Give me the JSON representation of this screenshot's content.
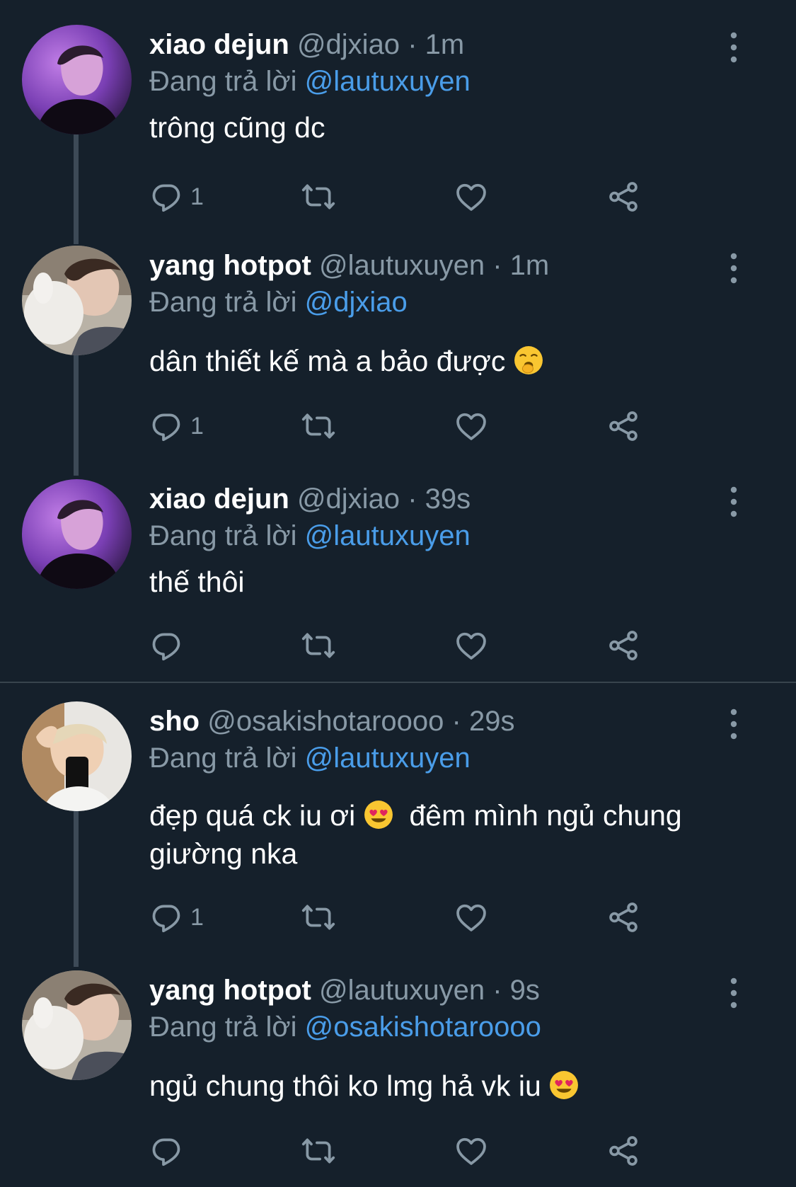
{
  "reply_prefix": "Đang trả lời",
  "colors": {
    "background": "#15202b",
    "secondary_text": "#8899a6",
    "mention": "#4a9de9",
    "thread_line": "#3d4a57"
  },
  "tweets": [
    {
      "name": "xiao dejun",
      "handle": "@djxiao",
      "separator": "·",
      "time": "1m",
      "reply_to": "@lautuxuyen",
      "text": "trông cũng dc",
      "reply_count": "1",
      "avatar": "avatar-xiao-dejun"
    },
    {
      "name": "yang hotpot",
      "handle": "@lautuxuyen",
      "separator": "·",
      "time": "1m",
      "reply_to": "@djxiao",
      "text": "dân thiết kế mà a bảo được",
      "emoji": "yawning-face-emoji",
      "reply_count": "1",
      "avatar": "avatar-yang-hotpot"
    },
    {
      "name": "xiao dejun",
      "handle": "@djxiao",
      "separator": "·",
      "time": "39s",
      "reply_to": "@lautuxuyen",
      "text": "thế thôi",
      "reply_count": "",
      "avatar": "avatar-xiao-dejun"
    },
    {
      "name": "sho",
      "handle": "@osakishotaroooo",
      "separator": "·",
      "time": "29s",
      "reply_to": "@lautuxuyen",
      "text_part1": "đẹp quá ck iu ơi",
      "emoji": "heart-eyes-emoji",
      "text_part2": "đêm mình ngủ chung",
      "text_line2": "giường nka",
      "reply_count": "1",
      "avatar": "avatar-sho"
    },
    {
      "name": "yang hotpot",
      "handle": "@lautuxuyen",
      "separator": "·",
      "time": "9s",
      "reply_to": "@osakishotaroooo",
      "text": "ngủ chung thôi ko lmg hả vk iu",
      "emoji": "heart-eyes-emoji",
      "reply_count": "",
      "avatar": "avatar-yang-hotpot"
    }
  ]
}
